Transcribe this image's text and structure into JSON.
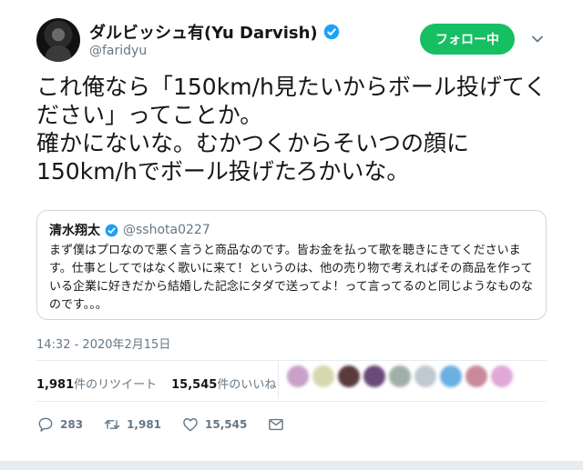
{
  "user": {
    "display_name": "ダルビッシュ有(Yu Darvish)",
    "handle": "@faridyu",
    "follow_label": "フォロー中"
  },
  "tweet": {
    "text": "これ俺なら「150km/h見たいからボール投げてください」ってことか。\n確かにないな。むかつくからそいつの顔に150km/hでボール投げたろかいな。",
    "timestamp": "14:32 - 2020年2月15日"
  },
  "quote": {
    "name": "清水翔太",
    "handle": "@sshota0227",
    "text": "まず僕はプロなので悪く言うと商品なのです。皆お金を払って歌を聴きにきてくださいます。仕事としてではなく歌いに来て！というのは、他の売り物で考えればその商品を作っている企業に好きだから結婚した記念にタダで送ってよ！って言ってるのと同じようなものなのです。。。"
  },
  "stats": {
    "retweets_count": "1,981",
    "retweets_label": "件のリツイート",
    "likes_count": "15,545",
    "likes_label": "件のいいね"
  },
  "likers": [
    {
      "color": "#c8a0c8"
    },
    {
      "color": "#d8d8b0"
    },
    {
      "color": "#5a3a3a"
    },
    {
      "color": "#6a4a7a"
    },
    {
      "color": "#a0b0a8"
    },
    {
      "color": "#c0c8d0"
    },
    {
      "color": "#6ab0e0"
    },
    {
      "color": "#c88a9a"
    },
    {
      "color": "#e0a8d8"
    }
  ],
  "actions": {
    "reply_count": "283",
    "retweet_count": "1,981",
    "like_count": "15,545"
  },
  "colors": {
    "follow_green": "#17bf63",
    "verified_blue": "#1da1f2",
    "muted_gray": "#657786"
  }
}
